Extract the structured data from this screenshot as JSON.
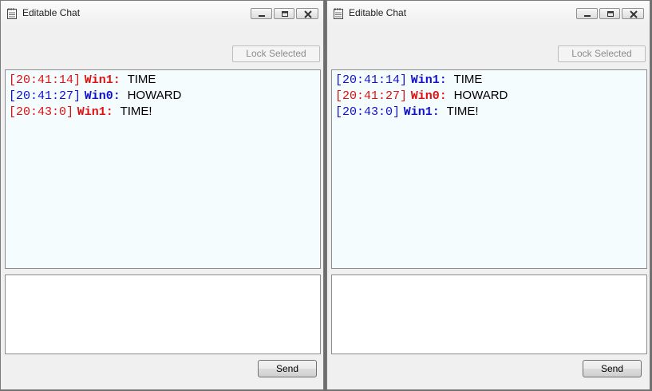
{
  "colors": {
    "red": "#dd1111",
    "blue": "#1111cc"
  },
  "windows": [
    {
      "title": "Editable Chat",
      "lock_label": "Lock Selected",
      "send_label": "Send",
      "input_value": "",
      "messages": [
        {
          "time": "[20:41:14]",
          "sender": "Win1:",
          "color": "red",
          "text": "TIME"
        },
        {
          "time": "[20:41:27]",
          "sender": "Win0:",
          "color": "blue",
          "text": "HOWARD"
        },
        {
          "time": "[20:43:0]",
          "sender": "Win1:",
          "color": "red",
          "text": "TIME!"
        }
      ]
    },
    {
      "title": "Editable Chat",
      "lock_label": "Lock Selected",
      "send_label": "Send",
      "input_value": "",
      "messages": [
        {
          "time": "[20:41:14]",
          "sender": "Win1:",
          "color": "blue",
          "text": "TIME"
        },
        {
          "time": "[20:41:27]",
          "sender": "Win0:",
          "color": "red",
          "text": "HOWARD"
        },
        {
          "time": "[20:43:0]",
          "sender": "Win1:",
          "color": "blue",
          "text": "TIME!"
        }
      ]
    }
  ]
}
